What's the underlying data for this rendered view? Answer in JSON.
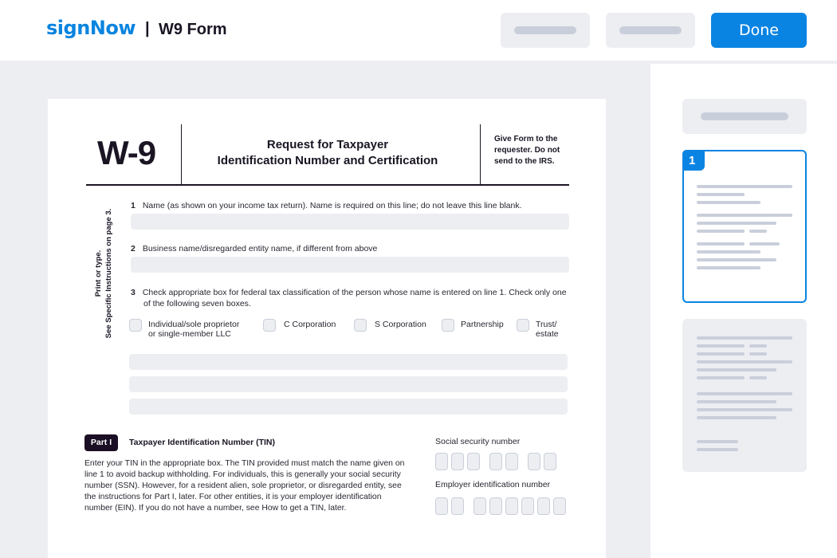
{
  "header": {
    "logo": "signNow",
    "separator": "|",
    "doc_title": "W9 Form",
    "done_label": "Done"
  },
  "colors": {
    "accent": "#0a84e3",
    "placeholder": "#c9cfda",
    "background": "#edeef2"
  },
  "sidebar": {
    "pages": [
      {
        "number": "1",
        "selected": true
      },
      {
        "selected": false
      }
    ]
  },
  "form": {
    "code": "W-9",
    "title_line1": "Request for Taxpayer",
    "title_line2": "Identification Number and Certification",
    "give_line1": "Give Form to the",
    "give_line2": "requester. Do not",
    "give_line3": "send to the IRS.",
    "side_line1": "Print or type.",
    "side_line2": "See Specific Instructions on page 3.",
    "line1": {
      "num": "1",
      "label": "Name (as shown on your income tax return). Name is required on this line; do not leave this line blank.",
      "value": ""
    },
    "line2": {
      "num": "2",
      "label": "Business name/disregarded entity name, if different from above",
      "value": ""
    },
    "line3": {
      "num": "3",
      "label_a": "Check appropriate box for federal tax classification of the person whose name is entered on line 1. Check only one",
      "label_b": "of the following seven boxes."
    },
    "classifications": [
      {
        "line1": "Individual/sole proprietor",
        "line2": "or single-member LLC",
        "checked": false
      },
      {
        "line1": "C Corporation",
        "line2": "",
        "checked": false
      },
      {
        "line1": "S Corporation",
        "line2": "",
        "checked": false
      },
      {
        "line1": "Partnership",
        "line2": "",
        "checked": false
      },
      {
        "line1": "Trust/",
        "line2": "estate",
        "checked": false
      }
    ],
    "part1": {
      "badge": "Part I",
      "title": "Taxpayer Identification Number (TIN)",
      "para": [
        "Enter your TIN in the appropriate box. The TIN provided must match the name given on",
        "line 1 to avoid backup withholding. For individuals, this is generally your social security",
        "number (SSN). However, for a resident alien, sole proprietor, or disregarded entity, see",
        "the instructions for Part I, later. For other entities, it is your employer identification",
        "number (EIN). If you do not have a number, see How to get a TIN, later."
      ],
      "ssn_label": "Social security number",
      "ein_label": "Employer identification number"
    }
  }
}
